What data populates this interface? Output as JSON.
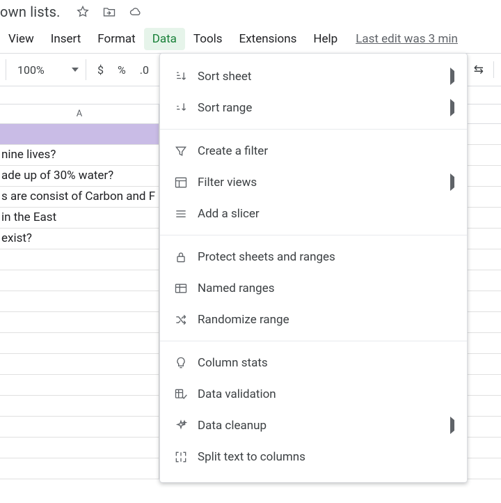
{
  "title_fragment": "own lists.",
  "menubar": {
    "items": [
      {
        "label": "View"
      },
      {
        "label": "Insert"
      },
      {
        "label": "Format"
      },
      {
        "label": "Data",
        "active": true
      },
      {
        "label": "Tools"
      },
      {
        "label": "Extensions"
      },
      {
        "label": "Help"
      }
    ],
    "last_edit": "Last edit was 3 min"
  },
  "toolbar": {
    "zoom": "100%",
    "currency": "$",
    "percent": "%",
    "decrease_dec": ".0",
    "tail_glyph": "⇆"
  },
  "grid": {
    "col_header": "A",
    "rows": [
      "",
      "nine lives?",
      "ade up of 30% water?",
      "s are consist of Carbon and F",
      "in the East",
      " exist?"
    ]
  },
  "data_menu": {
    "groups": [
      [
        {
          "id": "sort-sheet",
          "label": "Sort sheet",
          "submenu": true,
          "icon": "sort-sheet-icon"
        },
        {
          "id": "sort-range",
          "label": "Sort range",
          "submenu": true,
          "icon": "sort-range-icon"
        }
      ],
      [
        {
          "id": "create-filter",
          "label": "Create a filter",
          "icon": "filter-icon"
        },
        {
          "id": "filter-views",
          "label": "Filter views",
          "submenu": true,
          "icon": "filter-views-icon"
        },
        {
          "id": "add-slicer",
          "label": "Add a slicer",
          "icon": "slicer-icon"
        }
      ],
      [
        {
          "id": "protect",
          "label": "Protect sheets and ranges",
          "icon": "lock-icon"
        },
        {
          "id": "named-ranges",
          "label": "Named ranges",
          "icon": "named-ranges-icon"
        },
        {
          "id": "randomize",
          "label": "Randomize range",
          "icon": "shuffle-icon"
        }
      ],
      [
        {
          "id": "column-stats",
          "label": "Column stats",
          "icon": "bulb-icon"
        },
        {
          "id": "data-validation",
          "label": "Data validation",
          "icon": "validation-icon",
          "highlight": true
        },
        {
          "id": "data-cleanup",
          "label": "Data cleanup",
          "submenu": true,
          "icon": "sparkle-icon"
        },
        {
          "id": "split-text",
          "label": "Split text to columns",
          "icon": "split-icon"
        }
      ]
    ]
  }
}
